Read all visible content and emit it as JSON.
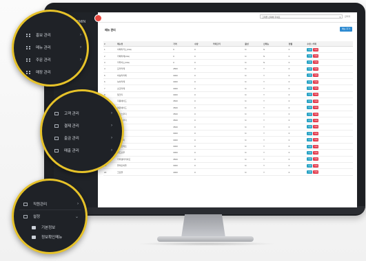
{
  "app": {
    "brand": "ADMIN",
    "page_title": "메뉴 관리",
    "add_button": "메뉴 추가",
    "top_select": "고객을 선택해 주세요",
    "top_user": "관리자"
  },
  "table": {
    "headers": [
      "#",
      "메뉴명",
      "가격",
      "수량",
      "카테고리",
      "활성",
      "신메뉴",
      "정렬",
      "수정 | 삭제"
    ],
    "rows": [
      {
        "no": "1",
        "name": "아메리카노(ICE)",
        "price": "0",
        "qty": "0",
        "cat": "",
        "active": "N",
        "new": "N",
        "sort": "0"
      },
      {
        "no": "2",
        "name": "카페라떼(ICE)",
        "price": "0",
        "qty": "0",
        "cat": "",
        "active": "N",
        "new": "N",
        "sort": "0"
      },
      {
        "no": "3",
        "name": "카푸치노(ICE)",
        "price": "0",
        "qty": "0",
        "cat": "",
        "active": "N",
        "new": "N",
        "sort": "0"
      },
      {
        "no": "4",
        "name": "모카라떼",
        "price": "2800",
        "qty": "0",
        "cat": "",
        "active": "N",
        "new": "Y",
        "sort": "0"
      },
      {
        "no": "5",
        "name": "바닐라라떼",
        "price": "3000",
        "qty": "0",
        "cat": "",
        "active": "N",
        "new": "Y",
        "sort": "0"
      },
      {
        "no": "6",
        "name": "녹차라떼",
        "price": "3000",
        "qty": "0",
        "cat": "",
        "active": "N",
        "new": "Y",
        "sort": "0"
      },
      {
        "no": "7",
        "name": "초코라떼",
        "price": "3000",
        "qty": "0",
        "cat": "",
        "active": "N",
        "new": "Y",
        "sort": "0"
      },
      {
        "no": "8",
        "name": "밀크티",
        "price": "3000",
        "qty": "0",
        "cat": "",
        "active": "N",
        "new": "Y",
        "sort": "0"
      },
      {
        "no": "9",
        "name": "자몽에이드",
        "price": "3500",
        "qty": "0",
        "cat": "",
        "active": "N",
        "new": "Y",
        "sort": "0"
      },
      {
        "no": "10",
        "name": "레몬에이드",
        "price": "3500",
        "qty": "0",
        "cat": "",
        "active": "N",
        "new": "Y",
        "sort": "0"
      },
      {
        "no": "11",
        "name": "딸기스무디",
        "price": "3500",
        "qty": "0",
        "cat": "",
        "active": "N",
        "new": "Y",
        "sort": "0"
      },
      {
        "no": "12",
        "name": "망고스무디",
        "price": "3500",
        "qty": "0",
        "cat": "",
        "active": "N",
        "new": "Y",
        "sort": "0"
      },
      {
        "no": "13",
        "name": "요거트",
        "price": "3500",
        "qty": "0",
        "cat": "",
        "active": "N",
        "new": "Y",
        "sort": "0"
      },
      {
        "no": "14",
        "name": "허브티",
        "price": "3000",
        "qty": "0",
        "cat": "",
        "active": "N",
        "new": "Y",
        "sort": "0"
      },
      {
        "no": "15",
        "name": "아이스티",
        "price": "3000",
        "qty": "0",
        "cat": "",
        "active": "N",
        "new": "Y",
        "sort": "0"
      },
      {
        "no": "16",
        "name": "에스프레소",
        "price": "3000",
        "qty": "0",
        "cat": "",
        "active": "N",
        "new": "Y",
        "sort": "0"
      },
      {
        "no": "17",
        "name": "콜드브루",
        "price": "3000",
        "qty": "0",
        "cat": "",
        "active": "N",
        "new": "Y",
        "sort": "0"
      },
      {
        "no": "18",
        "name": "카라멜마끼아또",
        "price": "3500",
        "qty": "0",
        "cat": "",
        "active": "N",
        "new": "Y",
        "sort": "0"
      },
      {
        "no": "19",
        "name": "플레인와플",
        "price": "3000",
        "qty": "0",
        "cat": "",
        "active": "N",
        "new": "Y",
        "sort": "0"
      },
      {
        "no": "20",
        "name": "크로플",
        "price": "4000",
        "qty": "0",
        "cat": "",
        "active": "N",
        "new": "Y",
        "sort": "0"
      }
    ],
    "edit_label": "수정",
    "delete_label": "삭제"
  },
  "callout1": {
    "items": [
      "홍보 관리",
      "메뉴 관리",
      "주문 관리",
      "매장 관리"
    ]
  },
  "callout2": {
    "items": [
      "고객 관리",
      "결제 관리",
      "출금 관리",
      "매출 관리"
    ]
  },
  "callout3": {
    "item": "직원관리",
    "settings": "설정",
    "sub": [
      "기본정보",
      "정보확인메뉴"
    ]
  },
  "colors": {
    "accent": "#e6c229",
    "primary": "#2d8ad1",
    "edit": "#27a2c4",
    "delete": "#e2394b",
    "sidebar": "#202328"
  }
}
